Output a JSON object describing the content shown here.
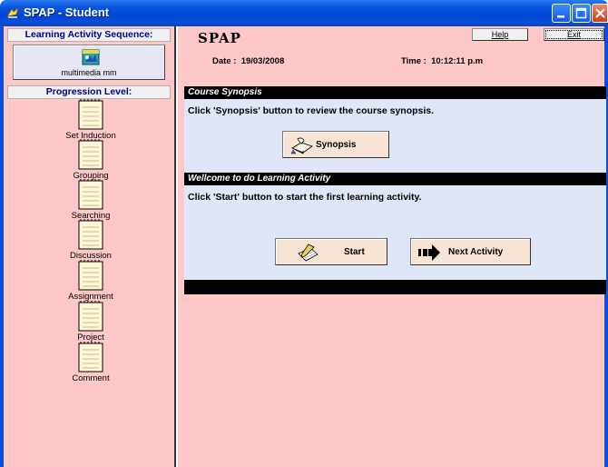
{
  "window": {
    "title": "SPAP - Student"
  },
  "sidebar": {
    "sequence_header": "Learning Activity Sequence:",
    "sequence_button_label": "multimedia mm",
    "progression_header": "Progression Level:",
    "levels": [
      {
        "label": "Set Induction"
      },
      {
        "label": "Grouping"
      },
      {
        "label": "Searching"
      },
      {
        "label": "Discussion"
      },
      {
        "label": "Assignment"
      },
      {
        "label": "Project"
      },
      {
        "label": "Comment"
      }
    ]
  },
  "header": {
    "app_name": "SPAP",
    "help_label": "Help",
    "exit_label": "Exit",
    "date_label": "Date :",
    "date_value": "19/03/2008",
    "time_label": "Time :",
    "time_value": "10:12:11 p.m"
  },
  "synopsis": {
    "title": "Course Synopsis",
    "instruction": "Click 'Synopsis' button to review the course synopsis.",
    "button_label": "Synopsis"
  },
  "activity": {
    "title": "Wellcome to do Learning Activity",
    "instruction": "Click 'Start' button to start the first learning activity.",
    "start_label": "Start",
    "next_label": "Next Activity"
  },
  "colors": {
    "background": "#ffc8c8",
    "content_panel": "#dfe6f7",
    "titlebar": "#0a57e0",
    "section_bar": "#000000"
  }
}
